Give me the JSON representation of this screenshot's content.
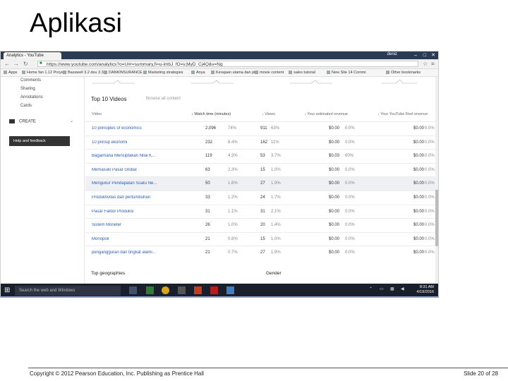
{
  "slide": {
    "title": "Aplikasi",
    "footer_left": "Copyright © 2012 Pearson Education, Inc. Publishing as Prentice Hall",
    "footer_right": "Slide 20 of 28"
  },
  "browser": {
    "tab_label": "Analytics - YouTube",
    "user": "deniz",
    "url": "https://www.youtube.com/analytics?o=U#r=summary,fi=u-imbJ_fO=v,MyD_Cj4Q&v=Ng",
    "bookmarks": [
      "Apps",
      "Home fan 1.12 Proyek",
      "Basswell 3.2 deu 3.3 s",
      "DANKINSURANCE",
      "Marketing strategies",
      "Anya",
      "Kerajaan utama dan pi",
      "movie content",
      "sales tutorial",
      "New Site 14 Commi",
      "Other bookmarks"
    ]
  },
  "sidebar": {
    "items": [
      "Comments",
      "Sharing",
      "Annotations",
      "Cards"
    ],
    "channel": "CREATE",
    "help_button": "Help and feedback"
  },
  "report": {
    "section_title": "Top 10 Videos",
    "browse_link": "Browse all content",
    "headers": {
      "video": "Video",
      "watch_time": "Watch time (minutes)",
      "views": "Views",
      "est_revenue": "Your estimated revenue",
      "yt_red_revenue": "Your YouTube Red revenue"
    },
    "rows": [
      {
        "title": "10 principles of economics",
        "watch": "2,096",
        "watch_pct": "74%",
        "views": "911",
        "views_pct": "63%",
        "rev": "$0.00",
        "rev_pct": "0.0%",
        "red": "$0.00",
        "red_pct": "0.0%"
      },
      {
        "title": "10 prinsip ekonomi",
        "watch": "232",
        "watch_pct": "8.4%",
        "views": "162",
        "views_pct": "11%",
        "rev": "$0.00",
        "rev_pct": "0.0%",
        "red": "$0.00",
        "red_pct": "0.0%"
      },
      {
        "title": "Bagaimana Menciptakan Nilai K...",
        "watch": "119",
        "watch_pct": "4.3%",
        "views": "53",
        "views_pct": "3.7%",
        "rev": "$0.03",
        "rev_pct": "60%",
        "red": "$0.00",
        "red_pct": "0.0%"
      },
      {
        "title": "Memasuki Pasar Global",
        "watch": "63",
        "watch_pct": "2.3%",
        "views": "15",
        "views_pct": "1.0%",
        "rev": "$0.00",
        "rev_pct": "0.0%",
        "red": "$0.00",
        "red_pct": "0.0%"
      },
      {
        "title": "Mengukur Pendapatan Suatu Ne...",
        "watch": "50",
        "watch_pct": "1.8%",
        "views": "27",
        "views_pct": "1.9%",
        "rev": "$0.00",
        "rev_pct": "0.0%",
        "red": "$0.00",
        "red_pct": "0.0%"
      },
      {
        "title": "Produktivitas dan pertumbuhan",
        "watch": "33",
        "watch_pct": "1.2%",
        "views": "24",
        "views_pct": "1.7%",
        "rev": "$0.00",
        "rev_pct": "0.0%",
        "red": "$0.00",
        "red_pct": "0.0%"
      },
      {
        "title": "Pasar Faktor Produksi",
        "watch": "31",
        "watch_pct": "1.1%",
        "views": "31",
        "views_pct": "2.1%",
        "rev": "$0.00",
        "rev_pct": "0.0%",
        "red": "$0.00",
        "red_pct": "0.0%"
      },
      {
        "title": "Sistem Moneter",
        "watch": "26",
        "watch_pct": "1.0%",
        "views": "20",
        "views_pct": "1.4%",
        "rev": "$0.00",
        "rev_pct": "0.0%",
        "red": "$0.00",
        "red_pct": "0.0%"
      },
      {
        "title": "Monopoli",
        "watch": "21",
        "watch_pct": "0.8%",
        "views": "15",
        "views_pct": "1.0%",
        "rev": "$0.00",
        "rev_pct": "0.0%",
        "red": "$0.00",
        "red_pct": "0.0%"
      },
      {
        "title": "pengangguran dan tingkat alami...",
        "watch": "21",
        "watch_pct": "0.7%",
        "views": "27",
        "views_pct": "1.9%",
        "rev": "$0.00",
        "rev_pct": "0.0%",
        "red": "$0.00",
        "red_pct": "0.0%"
      }
    ],
    "bottom_left": "Top geographies",
    "bottom_right": "Gender"
  },
  "taskbar": {
    "search_placeholder": "Search the web and Windows",
    "time": "8:31 AM",
    "date": "4/19/2016"
  }
}
